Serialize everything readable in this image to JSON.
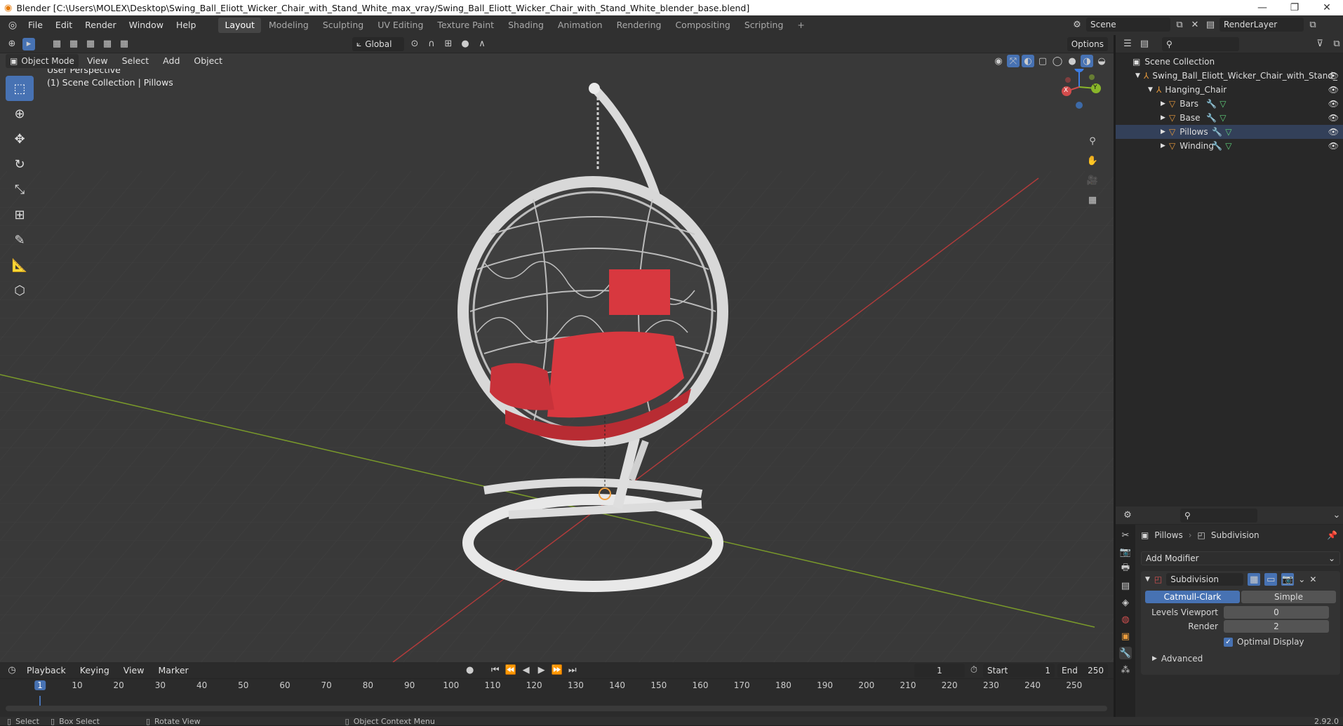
{
  "title_bar": {
    "text": "Blender [C:\\Users\\MOLEX\\Desktop\\Swing_Ball_Eliott_Wicker_Chair_with_Stand_White_max_vray/Swing_Ball_Eliott_Wicker_Chair_with_Stand_White_blender_base.blend]",
    "minimize": "—",
    "maximize": "❐",
    "close": "✕"
  },
  "menu": [
    "File",
    "Edit",
    "Render",
    "Window",
    "Help"
  ],
  "workspaces": [
    "Layout",
    "Modeling",
    "Sculpting",
    "UV Editing",
    "Texture Paint",
    "Shading",
    "Animation",
    "Rendering",
    "Compositing",
    "Scripting"
  ],
  "active_workspace": "Layout",
  "add_workspace": "+",
  "scene": {
    "label": "Scene",
    "render_layer": "RenderLayer"
  },
  "viewport_header": {
    "transform_orientation": "Global",
    "options": "Options",
    "mode": "Object Mode",
    "menus": [
      "View",
      "Select",
      "Add",
      "Object"
    ]
  },
  "viewport_overlay_text": {
    "perspective": "User Perspective",
    "collection": "(1) Scene Collection | Pillows"
  },
  "gizmo": {
    "x": "X",
    "y": "Y",
    "z": "Z"
  },
  "outliner": {
    "root": "Scene Collection",
    "object": "Swing_Ball_Eliott_Wicker_Chair_with_Stand_",
    "group": "Hanging_Chair",
    "children": [
      "Bars",
      "Base",
      "Pillows",
      "Winding"
    ],
    "selected_child": "Pillows"
  },
  "properties": {
    "object": "Pillows",
    "modifier_name": "Subdivision",
    "add_modifier": "Add Modifier",
    "mode_catmull": "Catmull-Clark",
    "mode_simple": "Simple",
    "levels_viewport_label": "Levels Viewport",
    "levels_viewport_value": "0",
    "render_label": "Render",
    "render_value": "2",
    "optimal_display": "Optimal Display",
    "advanced": "Advanced"
  },
  "timeline": {
    "menus": [
      "Playback",
      "Keying",
      "View",
      "Marker"
    ],
    "current_frame": "1",
    "start_label": "Start",
    "start": "1",
    "end_label": "End",
    "end": "250",
    "ticks": [
      "1",
      "10",
      "20",
      "30",
      "40",
      "50",
      "60",
      "70",
      "80",
      "90",
      "100",
      "110",
      "120",
      "130",
      "140",
      "150",
      "160",
      "170",
      "180",
      "190",
      "200",
      "210",
      "220",
      "230",
      "240",
      "250"
    ]
  },
  "status_bar": {
    "select": "Select",
    "box_select": "Box Select",
    "rotate_view": "Rotate View",
    "context_menu": "Object Context Menu",
    "version": "2.92.0"
  },
  "colors": {
    "accent": "#4772b3",
    "cushion": "#d8383f",
    "x_axis": "#d24c4c",
    "y_axis": "#8ab62a",
    "z_axis": "#3d7ee6"
  }
}
